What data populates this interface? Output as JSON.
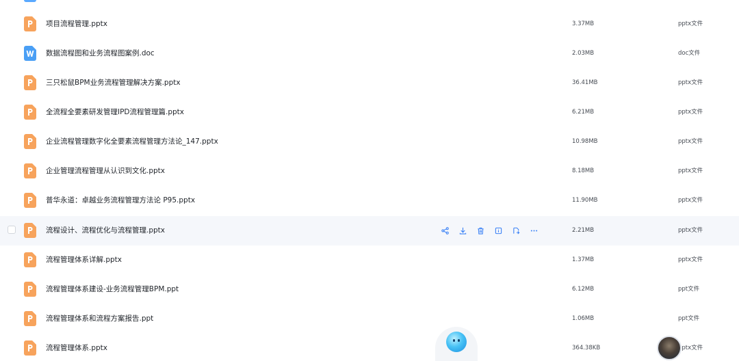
{
  "files": [
    {
      "name": "项目流程管理.pptx",
      "size": "3.37MB",
      "type": "pptx文件",
      "icon": "ppt-file-icon"
    },
    {
      "name": "数据流程图和业务流程图案例.doc",
      "size": "2.03MB",
      "type": "doc文件",
      "icon": "word-file-icon"
    },
    {
      "name": "三只松鼠BPM业务流程管理解决方案.pptx",
      "size": "36.41MB",
      "type": "pptx文件",
      "icon": "ppt-file-icon"
    },
    {
      "name": "全流程全要素研发管理IPD流程管理篇.pptx",
      "size": "6.21MB",
      "type": "pptx文件",
      "icon": "ppt-file-icon"
    },
    {
      "name": "企业流程管理数字化全要素流程管理方法论_147.pptx",
      "size": "10.98MB",
      "type": "pptx文件",
      "icon": "ppt-file-icon"
    },
    {
      "name": "企业管理流程管理从认识到文化.pptx",
      "size": "8.18MB",
      "type": "pptx文件",
      "icon": "ppt-file-icon"
    },
    {
      "name": "普华永道：卓越业务流程管理方法论 P95.pptx",
      "size": "11.90MB",
      "type": "pptx文件",
      "icon": "ppt-file-icon"
    },
    {
      "name": "流程设计、流程优化与流程管理.pptx",
      "size": "2.21MB",
      "type": "pptx文件",
      "icon": "ppt-file-icon"
    },
    {
      "name": "流程管理体系详解.pptx",
      "size": "1.37MB",
      "type": "pptx文件",
      "icon": "ppt-file-icon"
    },
    {
      "name": "流程管理体系建设-业务流程管理BPM.ppt",
      "size": "6.12MB",
      "type": "ppt文件",
      "icon": "ppt-file-icon"
    },
    {
      "name": "流程管理体系和流程方案报告.ppt",
      "size": "1.06MB",
      "type": "ppt文件",
      "icon": "ppt-file-icon"
    },
    {
      "name": "流程管理体系.pptx",
      "size": "364.38KB",
      "type": "pptx文件",
      "icon": "ppt-file-icon"
    }
  ],
  "hovered_row": 7,
  "row_actions": [
    "share-icon",
    "download-icon",
    "delete-icon",
    "info-icon",
    "move-icon",
    "more-icon"
  ],
  "colors": {
    "ppt_icon": "#f7a35c",
    "word_icon": "#4a9ff5",
    "action_icon": "#3b82f6",
    "hover_row": "#f5f7fb"
  }
}
